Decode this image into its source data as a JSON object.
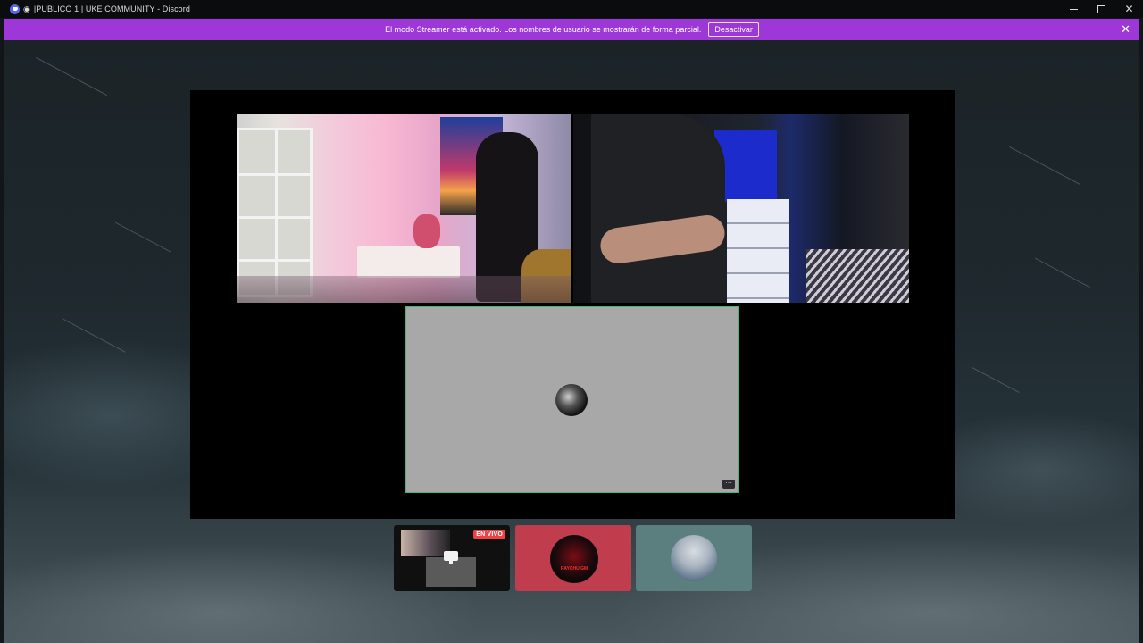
{
  "window": {
    "title": "|PUBLICO 1 | UKE COMMUNITY - Discord",
    "controls": {
      "minimize": "—",
      "maximize": "□",
      "close": "✕"
    }
  },
  "banner": {
    "text": "El modo Streamer está activado. Los nombres de usuario se mostrarán de forma parcial.",
    "button_label": "Desactivar",
    "close_glyph": "✕",
    "color": "#9d37d8"
  },
  "stage": {
    "tiles": [
      "camera-feed-1",
      "camera-feed-2",
      "screen-share"
    ],
    "more_glyph": "···",
    "speaking_color": "#43b581"
  },
  "participants": [
    {
      "badge": "EN VIVO"
    },
    {
      "avatar_text": "RAYCHU GM",
      "color": "#bf3d4d"
    },
    {
      "color": "#5b7f7f"
    }
  ]
}
